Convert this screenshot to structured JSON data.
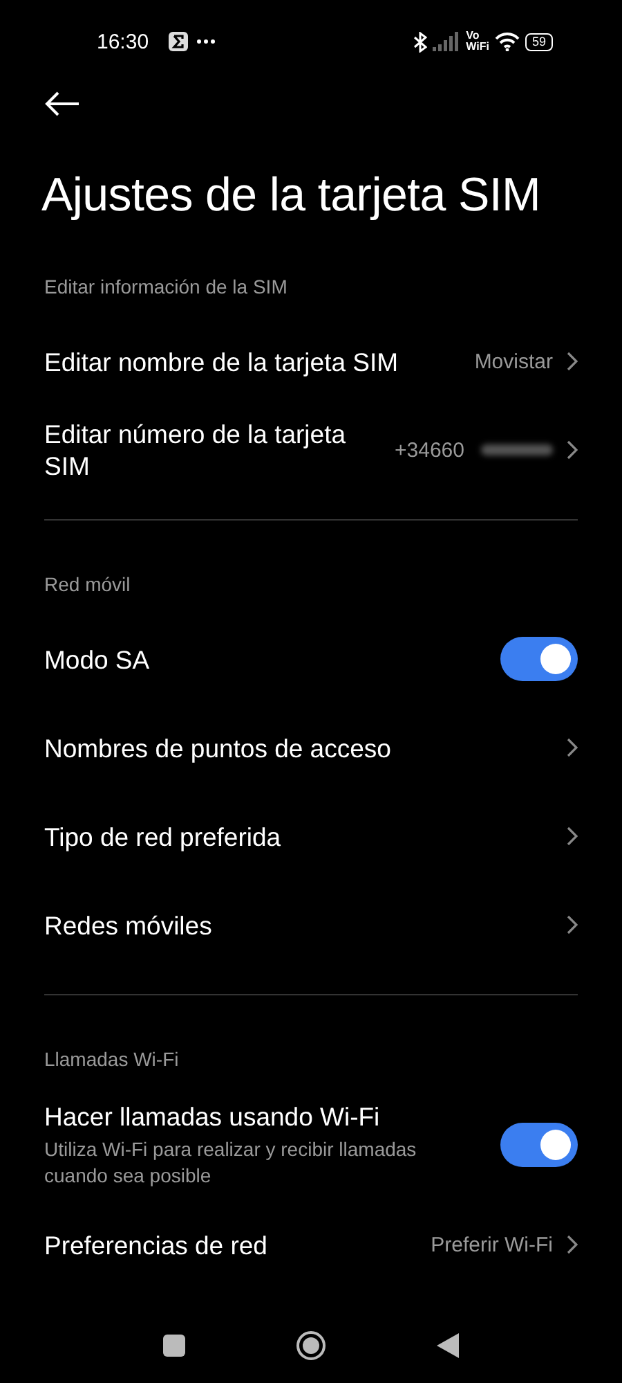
{
  "status_bar": {
    "time": "16:30",
    "vowifi": [
      "Vo",
      "WiFi"
    ],
    "battery": "59"
  },
  "title": "Ajustes de la tarjeta SIM",
  "sections": [
    {
      "header": "Editar información de la SIM",
      "items": [
        {
          "kind": "link",
          "label": "Editar nombre de la tarjeta SIM",
          "value": "Movistar"
        },
        {
          "kind": "link",
          "label": "Editar número de la tarjeta SIM",
          "value": "+34660",
          "redacted": true
        }
      ]
    },
    {
      "header": "Red móvil",
      "items": [
        {
          "kind": "toggle",
          "label": "Modo SA",
          "on": true
        },
        {
          "kind": "link",
          "label": "Nombres de puntos de acceso"
        },
        {
          "kind": "link",
          "label": "Tipo de red preferida"
        },
        {
          "kind": "link",
          "label": "Redes móviles"
        }
      ]
    },
    {
      "header": "Llamadas Wi-Fi",
      "items": [
        {
          "kind": "toggle",
          "label": "Hacer llamadas usando Wi-Fi",
          "subtitle": "Utiliza Wi-Fi para realizar y recibir llamadas cuando sea posible",
          "on": true
        },
        {
          "kind": "link",
          "label": "Preferencias de red",
          "value": "Preferir Wi-Fi"
        }
      ]
    }
  ]
}
